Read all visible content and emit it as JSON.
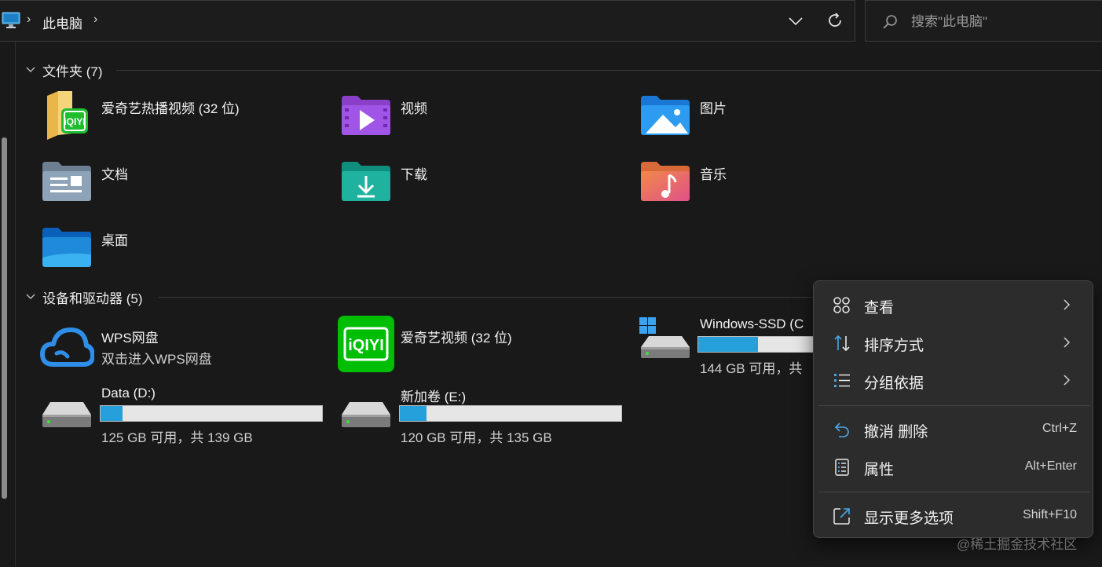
{
  "address_bar": {
    "location": "此电脑",
    "search_placeholder": "搜索\"此电脑\""
  },
  "groups": {
    "folders": {
      "title": "文件夹 (7)"
    },
    "devices": {
      "title": "设备和驱动器 (5)"
    }
  },
  "folders": [
    {
      "name": "爱奇艺热播视频 (32 位)",
      "icon": "iqiyi-folder-icon"
    },
    {
      "name": "视频",
      "icon": "videos-folder-icon"
    },
    {
      "name": "图片",
      "icon": "pictures-folder-icon"
    },
    {
      "name": "文档",
      "icon": "documents-folder-icon"
    },
    {
      "name": "下载",
      "icon": "downloads-folder-icon"
    },
    {
      "name": "音乐",
      "icon": "music-folder-icon"
    },
    {
      "name": "桌面",
      "icon": "desktop-folder-icon"
    }
  ],
  "devices": [
    {
      "name": "WPS网盘",
      "subtitle": "双击进入WPS网盘",
      "icon": "wps-cloud-icon"
    },
    {
      "name": "爱奇艺视频 (32 位)",
      "icon": "iqiyi-app-icon"
    },
    {
      "name": "Windows-SSD (C",
      "usage_text": "144 GB 可用，共",
      "used_fraction": 0.48,
      "icon": "windows-drive-icon"
    },
    {
      "name": "Data (D:)",
      "usage_text": "125 GB 可用，共 139 GB",
      "used_fraction": 0.1,
      "icon": "drive-icon"
    },
    {
      "name": "新加卷 (E:)",
      "usage_text": "120 GB 可用，共 135 GB",
      "used_fraction": 0.12,
      "icon": "drive-icon"
    }
  ],
  "context_menu": {
    "items": [
      {
        "label": "查看",
        "icon": "grid-view-icon",
        "has_submenu": true
      },
      {
        "label": "排序方式",
        "icon": "sort-icon",
        "has_submenu": true
      },
      {
        "label": "分组依据",
        "icon": "group-by-icon",
        "has_submenu": true
      },
      {
        "label": "撤消 删除",
        "icon": "undo-icon",
        "shortcut": "Ctrl+Z"
      },
      {
        "label": "属性",
        "icon": "properties-icon",
        "shortcut": "Alt+Enter"
      },
      {
        "label": "显示更多选项",
        "icon": "more-options-icon",
        "shortcut": "Shift+F10"
      }
    ]
  },
  "colors": {
    "background": "#191919",
    "accent": "#26a0da",
    "menu_background": "#2c2c2c"
  },
  "watermark": "@稀土掘金技术社区"
}
